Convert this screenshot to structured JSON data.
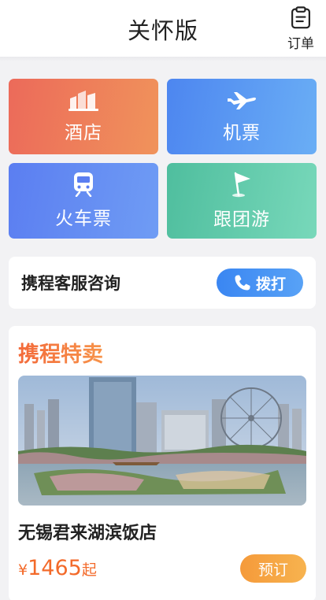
{
  "header": {
    "title": "关怀版",
    "order_label": "订单",
    "order_icon": "clipboard-icon"
  },
  "tiles": [
    {
      "label": "酒店",
      "icon": "hotel-icon"
    },
    {
      "label": "机票",
      "icon": "airplane-icon"
    },
    {
      "label": "火车票",
      "icon": "train-icon"
    },
    {
      "label": "跟团游",
      "icon": "flag-icon"
    }
  ],
  "service": {
    "title": "携程客服咨询",
    "call_label": "拨打",
    "call_icon": "phone-icon"
  },
  "deal": {
    "title": "携程特卖",
    "hotel_name": "无锡君来湖滨饭店",
    "price_currency": "¥",
    "price_value": "1465",
    "price_suffix": "起",
    "book_label": "预订"
  },
  "colors": {
    "hotel_tile": "#ec6a5a",
    "flight_tile": "#4d86f0",
    "train_tile": "#5b7ef1",
    "tour_tile": "#4fbe9e",
    "price": "#f36a2a",
    "call_button": "#3a86f2",
    "book_button": "#f59a3a"
  }
}
